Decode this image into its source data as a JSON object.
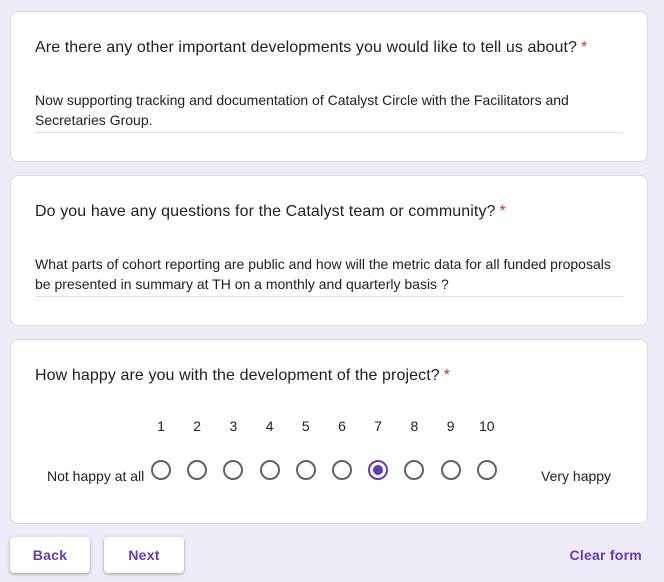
{
  "colors": {
    "accent": "#673ab7",
    "background": "#f0ebf8",
    "required": "#d93025"
  },
  "questions": [
    {
      "title": "Are there any other important developments you would like to tell us about?",
      "required_mark": "*",
      "answer": "Now supporting tracking and documentation of Catalyst Circle with the Facilitators and Secretaries Group."
    },
    {
      "title": "Do you have any questions for the Catalyst team or community?",
      "required_mark": "*",
      "answer": "What parts of cohort reporting are public and how will the metric data for all funded proposals be presented in summary at TH on a monthly and quarterly basis ?"
    },
    {
      "title": "How happy are you with the development of the project?",
      "required_mark": "*",
      "scale": {
        "low_label": "Not happy at all",
        "high_label": "Very happy",
        "options": [
          "1",
          "2",
          "3",
          "4",
          "5",
          "6",
          "7",
          "8",
          "9",
          "10"
        ],
        "selected": "7"
      }
    }
  ],
  "nav": {
    "back_label": "Back",
    "next_label": "Next",
    "clear_label": "Clear form"
  }
}
